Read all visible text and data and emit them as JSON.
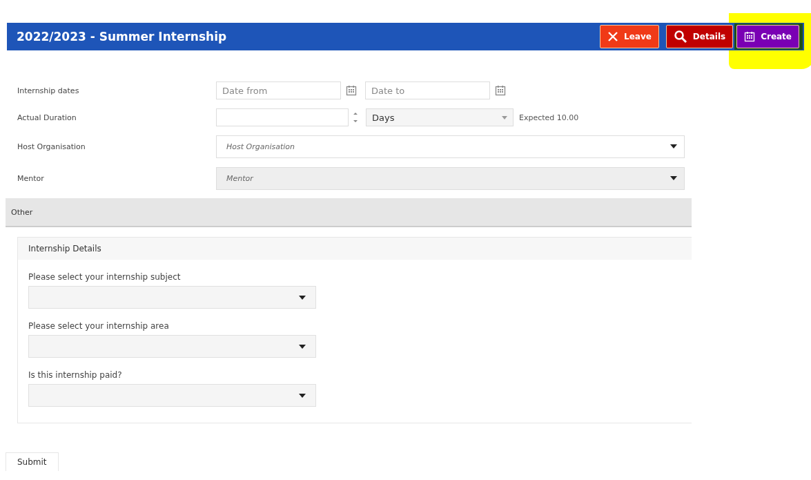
{
  "header": {
    "title": "2022/2023 - Summer Internship"
  },
  "header_buttons": [
    {
      "label": "Leave",
      "kind": "close",
      "color": "#f03a17",
      "highlighted": false
    },
    {
      "label": "Details",
      "kind": "search",
      "color": "#c00000",
      "highlighted": false
    },
    {
      "label": "Create",
      "kind": "calendar",
      "color": "#7a00b4",
      "highlighted": true
    }
  ],
  "fields": [
    {
      "kind": "date_range",
      "label": "Internship dates",
      "from_placeholder": "Date from",
      "to_placeholder": "Date to"
    },
    {
      "kind": "duration",
      "label": "Actual Duration",
      "unit": "Days",
      "expected": "Expected 10.00"
    },
    {
      "kind": "select",
      "label": "Host Organisation",
      "placeholder": "Host Organisation",
      "shaded": false
    },
    {
      "kind": "select",
      "label": "Mentor",
      "placeholder": "Mentor",
      "shaded": true
    }
  ],
  "section": {
    "title": "Other"
  },
  "panel": {
    "title": "Internship Details",
    "questions": [
      {
        "label": "Please select your internship subject"
      },
      {
        "label": "Please select your internship area"
      },
      {
        "label": "Is this internship paid?"
      }
    ]
  },
  "submit": {
    "label": "Submit"
  }
}
